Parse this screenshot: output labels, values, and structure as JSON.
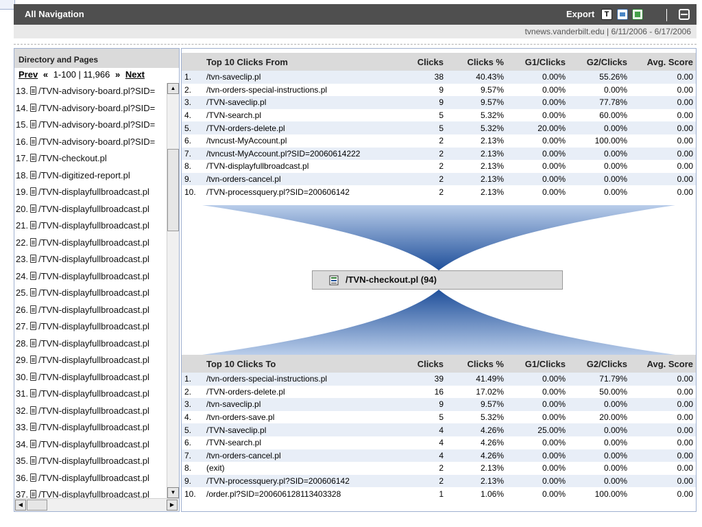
{
  "header": {
    "title": "All Navigation",
    "export_label": "Export",
    "text_icon_label": "T",
    "site_info": "tvnews.vanderbilt.edu  |  6/11/2006 - 6/17/2006"
  },
  "directory": {
    "title": "Directory and Pages",
    "prev_label": "Prev",
    "range_label": "1-100 | 11,966",
    "next_label": "Next",
    "prev_arrow": "«",
    "next_arrow": "»",
    "items": [
      {
        "label": "13.  /TVN-advisory-board.pl?SID="
      },
      {
        "label": "14.  /TVN-advisory-board.pl?SID="
      },
      {
        "label": "15.  /TVN-advisory-board.pl?SID="
      },
      {
        "label": "16.  /TVN-advisory-board.pl?SID="
      },
      {
        "label": "17.  /TVN-checkout.pl"
      },
      {
        "label": "18.  /TVN-digitized-report.pl"
      },
      {
        "label": "19.  /TVN-displayfullbroadcast.pl"
      },
      {
        "label": "20.  /TVN-displayfullbroadcast.pl"
      },
      {
        "label": "21.  /TVN-displayfullbroadcast.pl"
      },
      {
        "label": "22.  /TVN-displayfullbroadcast.pl"
      },
      {
        "label": "23.  /TVN-displayfullbroadcast.pl"
      },
      {
        "label": "24.  /TVN-displayfullbroadcast.pl"
      },
      {
        "label": "25.  /TVN-displayfullbroadcast.pl"
      },
      {
        "label": "26.  /TVN-displayfullbroadcast.pl"
      },
      {
        "label": "27.  /TVN-displayfullbroadcast.pl"
      },
      {
        "label": "28.  /TVN-displayfullbroadcast.pl"
      },
      {
        "label": "29.  /TVN-displayfullbroadcast.pl"
      },
      {
        "label": "30.  /TVN-displayfullbroadcast.pl"
      },
      {
        "label": "31.  /TVN-displayfullbroadcast.pl"
      },
      {
        "label": "32.  /TVN-displayfullbroadcast.pl"
      },
      {
        "label": "33.  /TVN-displayfullbroadcast.pl"
      },
      {
        "label": "34.  /TVN-displayfullbroadcast.pl"
      },
      {
        "label": "35.  /TVN-displayfullbroadcast.pl"
      },
      {
        "label": "36.  /TVN-displayfullbroadcast.pl"
      },
      {
        "label": "37.  /TVN-displayfullbroadcast.pl"
      }
    ]
  },
  "columns": {
    "clicks": "Clicks",
    "clicks_pct": "Clicks %",
    "g1": "G1/Clicks",
    "g2": "G2/Clicks",
    "avg": "Avg. Score"
  },
  "from_table": {
    "title": "Top 10 Clicks From",
    "rows": [
      {
        "num": "1.",
        "page": "/tvn-saveclip.pl",
        "clicks": "38",
        "pct": "40.43%",
        "g1": "0.00%",
        "g2": "55.26%",
        "avg": "0.00"
      },
      {
        "num": "2.",
        "page": "/tvn-orders-special-instructions.pl",
        "clicks": "9",
        "pct": "9.57%",
        "g1": "0.00%",
        "g2": "0.00%",
        "avg": "0.00"
      },
      {
        "num": "3.",
        "page": "/TVN-saveclip.pl",
        "clicks": "9",
        "pct": "9.57%",
        "g1": "0.00%",
        "g2": "77.78%",
        "avg": "0.00"
      },
      {
        "num": "4.",
        "page": "/TVN-search.pl",
        "clicks": "5",
        "pct": "5.32%",
        "g1": "0.00%",
        "g2": "60.00%",
        "avg": "0.00"
      },
      {
        "num": "5.",
        "page": "/TVN-orders-delete.pl",
        "clicks": "5",
        "pct": "5.32%",
        "g1": "20.00%",
        "g2": "0.00%",
        "avg": "0.00"
      },
      {
        "num": "6.",
        "page": "/tvncust-MyAccount.pl",
        "clicks": "2",
        "pct": "2.13%",
        "g1": "0.00%",
        "g2": "100.00%",
        "avg": "0.00"
      },
      {
        "num": "7.",
        "page": "/tvncust-MyAccount.pl?SID=20060614222",
        "clicks": "2",
        "pct": "2.13%",
        "g1": "0.00%",
        "g2": "0.00%",
        "avg": "0.00"
      },
      {
        "num": "8.",
        "page": "/TVN-displayfullbroadcast.pl",
        "clicks": "2",
        "pct": "2.13%",
        "g1": "0.00%",
        "g2": "0.00%",
        "avg": "0.00"
      },
      {
        "num": "9.",
        "page": "/tvn-orders-cancel.pl",
        "clicks": "2",
        "pct": "2.13%",
        "g1": "0.00%",
        "g2": "0.00%",
        "avg": "0.00"
      },
      {
        "num": "10.",
        "page": "/TVN-processquery.pl?SID=200606142",
        "clicks": "2",
        "pct": "2.13%",
        "g1": "0.00%",
        "g2": "0.00%",
        "avg": "0.00"
      }
    ]
  },
  "center_node": {
    "label": "/TVN-checkout.pl (94)"
  },
  "to_table": {
    "title": "Top 10 Clicks To",
    "rows": [
      {
        "num": "1.",
        "page": "/tvn-orders-special-instructions.pl",
        "clicks": "39",
        "pct": "41.49%",
        "g1": "0.00%",
        "g2": "71.79%",
        "avg": "0.00"
      },
      {
        "num": "2.",
        "page": "/TVN-orders-delete.pl",
        "clicks": "16",
        "pct": "17.02%",
        "g1": "0.00%",
        "g2": "50.00%",
        "avg": "0.00"
      },
      {
        "num": "3.",
        "page": "/tvn-saveclip.pl",
        "clicks": "9",
        "pct": "9.57%",
        "g1": "0.00%",
        "g2": "0.00%",
        "avg": "0.00"
      },
      {
        "num": "4.",
        "page": "/tvn-orders-save.pl",
        "clicks": "5",
        "pct": "5.32%",
        "g1": "0.00%",
        "g2": "20.00%",
        "avg": "0.00"
      },
      {
        "num": "5.",
        "page": "/TVN-saveclip.pl",
        "clicks": "4",
        "pct": "4.26%",
        "g1": "25.00%",
        "g2": "0.00%",
        "avg": "0.00"
      },
      {
        "num": "6.",
        "page": "/TVN-search.pl",
        "clicks": "4",
        "pct": "4.26%",
        "g1": "0.00%",
        "g2": "0.00%",
        "avg": "0.00"
      },
      {
        "num": "7.",
        "page": "/tvn-orders-cancel.pl",
        "clicks": "4",
        "pct": "4.26%",
        "g1": "0.00%",
        "g2": "0.00%",
        "avg": "0.00"
      },
      {
        "num": "8.",
        "page": "(exit)",
        "clicks": "2",
        "pct": "2.13%",
        "g1": "0.00%",
        "g2": "0.00%",
        "avg": "0.00"
      },
      {
        "num": "9.",
        "page": "/TVN-processquery.pl?SID=200606142",
        "clicks": "2",
        "pct": "2.13%",
        "g1": "0.00%",
        "g2": "0.00%",
        "avg": "0.00"
      },
      {
        "num": "10.",
        "page": "/order.pl?SID=200606128113403328",
        "clicks": "1",
        "pct": "1.06%",
        "g1": "0.00%",
        "g2": "100.00%",
        "avg": "0.00"
      }
    ]
  },
  "colors": {
    "navbar": "#4f4f4f",
    "row_alt": "#e8eef7",
    "flow_dark": "#1f4f9a",
    "flow_light": "#b9cdea"
  },
  "icons": {
    "export_text": "text-export-icon",
    "export_html": "html-export-icon",
    "export_excel": "excel-export-icon",
    "print": "print-icon",
    "page": "page-icon"
  }
}
